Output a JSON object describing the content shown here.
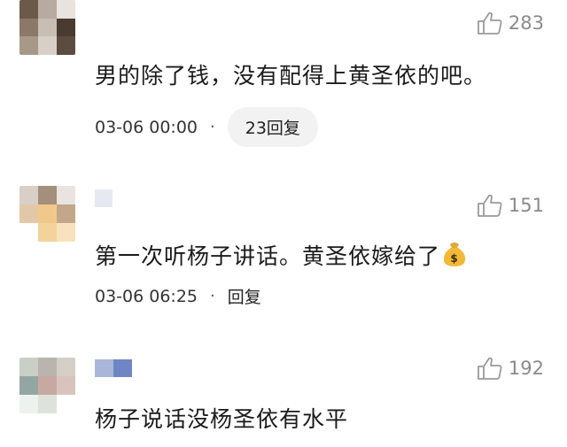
{
  "comments": [
    {
      "text": "男的除了钱，没有配得上黄圣依的吧。",
      "likes": "283",
      "time": "03-06 00:00",
      "reply_label": "23回复",
      "reply_style": "pill"
    },
    {
      "text": "第一次听杨子讲话。黄圣依嫁给了",
      "emoji_icon": "money-bag-icon",
      "likes": "151",
      "time": "03-06 06:25",
      "reply_label": "回复",
      "reply_style": "plain"
    },
    {
      "text": "杨子说话没杨圣依有水平",
      "likes": "192"
    }
  ],
  "separator": "·",
  "colors": {
    "like_gray": "#8a8a8a",
    "pill_bg": "#f2f2f2"
  }
}
